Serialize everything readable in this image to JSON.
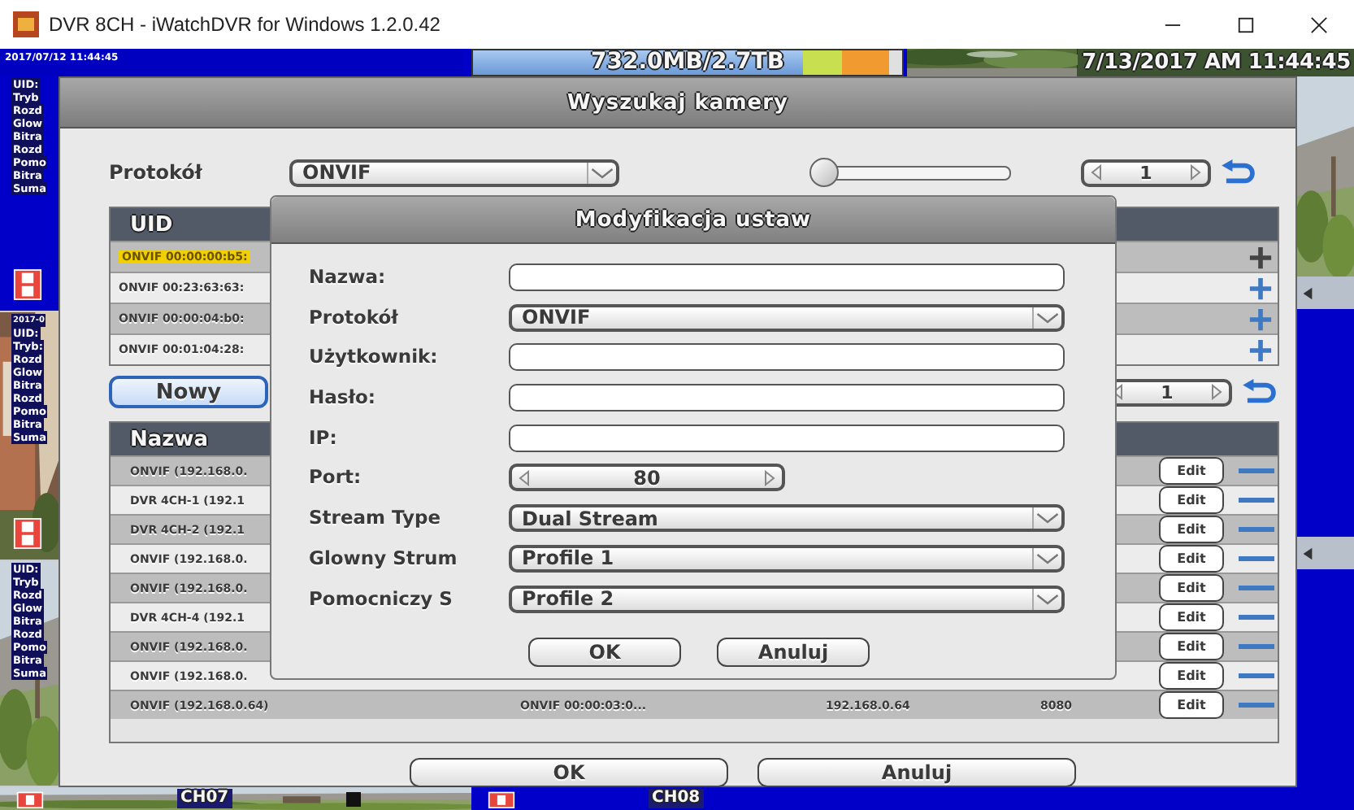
{
  "window": {
    "title": "DVR 8CH - iWatchDVR for Windows 1.2.0.42"
  },
  "top_bar": {
    "left_time": "2017/07/12 11:44:45",
    "disk": {
      "text": "732.0MB/2.7TB",
      "level": 0.77
    },
    "right_time": "7/13/2017 AM 11:44:45"
  },
  "left_tiles": [
    {
      "kind": "blue",
      "recording": true,
      "lines": [
        "UID:",
        "Tryb",
        "Rozd",
        "Glow",
        "Bitra",
        "Rozd",
        "Pomo",
        "Bitra",
        "Suma"
      ]
    },
    {
      "kind": "picture",
      "recording": true,
      "time": "2017-0",
      "lines": [
        "UID:",
        "Tryb:",
        "Rozd",
        "Glow",
        "Bitra",
        "Rozd",
        "Pomo",
        "Bitra",
        "Suma"
      ]
    },
    {
      "kind": "picture",
      "recording": false,
      "lines": [
        "UID:",
        "Tryb",
        "Rozd",
        "Glow",
        "Bitra",
        "Rozd",
        "Pomo",
        "Bitra",
        "Suma"
      ]
    }
  ],
  "channels": [
    {
      "label": "CH07",
      "kind": "picture"
    },
    {
      "label": "CH08",
      "kind": "blue"
    }
  ],
  "search_dialog": {
    "title": "Wyszukaj kamery",
    "protocol_label": "Protokół",
    "protocol_value": "ONVIF",
    "slider": {
      "level": 0.0
    },
    "page": "1",
    "uid_table": {
      "header": "UID",
      "rows": [
        {
          "text": "ONVIF 00:00:00:b5:",
          "selected": true
        },
        {
          "text": "ONVIF 00:23:63:63:",
          "selected": false
        },
        {
          "text": "ONVIF 00:00:04:b0:",
          "selected": false
        },
        {
          "text": "ONVIF 00:01:04:28:",
          "selected": false
        }
      ]
    },
    "new_button": "Nowy",
    "page2": "1",
    "name_table": {
      "header": "Nazwa",
      "rows": [
        {
          "name": "ONVIF (192.168.0.",
          "edit": "Edit"
        },
        {
          "name": "DVR 4CH-1 (192.1",
          "edit": "Edit"
        },
        {
          "name": "DVR 4CH-2 (192.1",
          "edit": "Edit"
        },
        {
          "name": "ONVIF (192.168.0.",
          "edit": "Edit"
        },
        {
          "name": "ONVIF (192.168.0.",
          "edit": "Edit"
        },
        {
          "name": "DVR 4CH-4 (192.1",
          "edit": "Edit"
        },
        {
          "name": "ONVIF (192.168.0.",
          "edit": "Edit"
        },
        {
          "name": "ONVIF (192.168.0.",
          "edit": "Edit"
        },
        {
          "name": "ONVIF (192.168.0.64)",
          "uid": "ONVIF 00:00:03:0...",
          "ip": "192.168.0.64",
          "port": "8080",
          "edit": "Edit"
        }
      ]
    },
    "buttons": [
      "OK",
      "Anuluj"
    ]
  },
  "modal": {
    "title": "Modyfikacja ustaw",
    "fields": [
      {
        "label": "Nazwa:",
        "kind": "input"
      },
      {
        "label": "Protokół",
        "kind": "select",
        "value": "ONVIF"
      },
      {
        "label": "Użytkownik:",
        "kind": "input"
      },
      {
        "label": "Hasło:",
        "kind": "input"
      },
      {
        "label": "IP:",
        "kind": "input"
      },
      {
        "label": "Port:",
        "kind": "spinner",
        "value": "80"
      },
      {
        "label": "Stream Type",
        "kind": "select",
        "value": "Dual Stream"
      },
      {
        "label": "Glowny Strum",
        "kind": "select",
        "value": "Profile 1"
      },
      {
        "label": "Pomocniczy S",
        "kind": "select",
        "value": "Profile 2"
      }
    ],
    "buttons": [
      "OK",
      "Anuluj"
    ]
  }
}
